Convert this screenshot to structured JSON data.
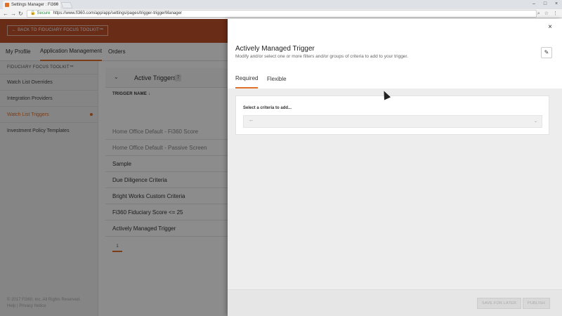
{
  "browser": {
    "tab_title": "Settings Manager : Fi360",
    "url_secure": "Secure",
    "url": "https://www.fi360.com/app/app/settings/pages/trigger-triggerManager",
    "back_icon": "←",
    "forward_icon": "→",
    "reload_icon": "↻"
  },
  "header": {
    "back_button": "← BACK TO FIDUCIARY FOCUS TOOLKIT™"
  },
  "nav": {
    "items": [
      "My Profile",
      "Application Management",
      "Orders"
    ]
  },
  "sidebar": {
    "heading": "FIDUCIARY FOCUS TOOLKIT™",
    "items": [
      "Watch List Overrides",
      "Integration Providers",
      "Watch List Triggers",
      "Investment Policy Templates"
    ],
    "copyright": "© 2017 Fi360, Inc. All Rights Reserved. Help | Privacy Notice"
  },
  "triggers": {
    "title": "Active Triggers",
    "count": "7",
    "column": "TRIGGER NAME ↓",
    "rows": [
      "Home Office Default - Fi360 Score",
      "Home Office Default - Passive Screen",
      "Sample",
      "Due Diligence Criteria",
      "Bright Works Custom Criteria",
      "Fi360 Fiduciary Score <= 25",
      "Actively Managed Trigger"
    ],
    "page": "1"
  },
  "panel": {
    "title": "Actively Managed Trigger",
    "subtitle": "Modify and/or select one or more filters and/or groups of criteria to add to your trigger.",
    "tabs": [
      "Required",
      "Flexible"
    ],
    "criteria_label": "Select a criteria to add...",
    "select_value": "--",
    "save_later": "SAVE FOR LATER",
    "publish": "PUBLISH"
  },
  "colors": {
    "accent": "#e0702a",
    "header": "#c0502a"
  }
}
